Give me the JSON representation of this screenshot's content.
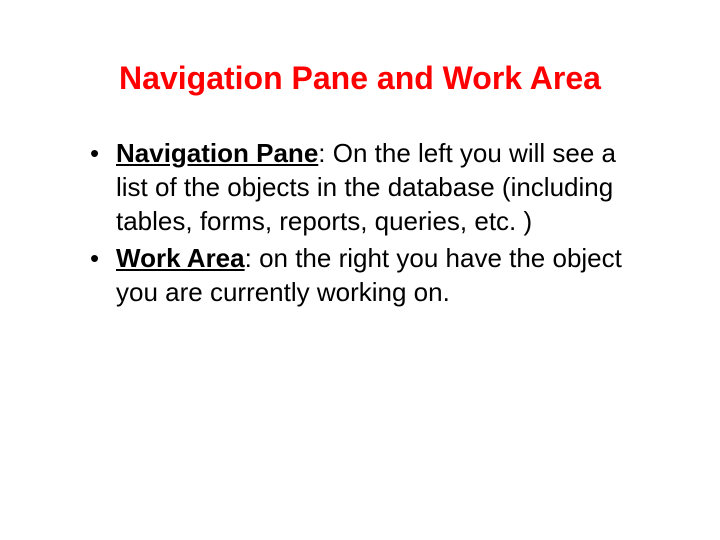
{
  "slide": {
    "title": "Navigation Pane and Work Area",
    "bullets": [
      {
        "term": "Navigation Pane",
        "colon": ": ",
        "text": "On the left you will see a list of the objects in the database (including tables, forms, reports, queries, etc. )"
      },
      {
        "term": "Work Area",
        "colon": ": ",
        "text": "on the right you have the object you are currently working on."
      }
    ]
  }
}
